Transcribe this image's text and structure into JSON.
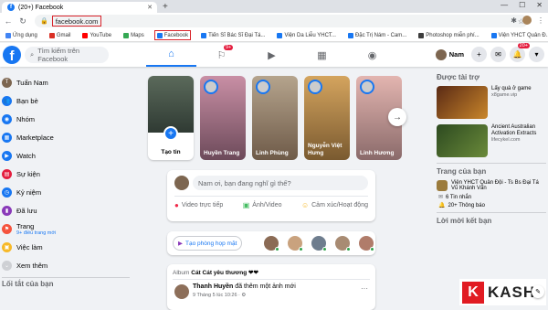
{
  "browser": {
    "tab_title": "(20+) Facebook",
    "url": "facebook.com",
    "bookmarks": [
      {
        "label": "Ứng dụng",
        "color": "#4285f4"
      },
      {
        "label": "Gmail",
        "color": "#d93025"
      },
      {
        "label": "YouTube",
        "color": "#ff0000"
      },
      {
        "label": "Maps",
        "color": "#34a853"
      },
      {
        "label": "Facebook",
        "color": "#1877f2"
      },
      {
        "label": "Tiến Sĩ Bác Sĩ Đại Tá...",
        "color": "#1877f2"
      },
      {
        "label": "Viện Da Liễu YHCT...",
        "color": "#1877f2"
      },
      {
        "label": "Đặc Trị Nám - Cam...",
        "color": "#1877f2"
      },
      {
        "label": "Photoshop miễn phí...",
        "color": "#3c3c3c"
      },
      {
        "label": "Viện YHCT Quân Đ...",
        "color": "#1877f2"
      }
    ]
  },
  "fb": {
    "search_placeholder": "Tìm kiếm trên Facebook",
    "nav_badge": "9+",
    "profile_name": "Nam",
    "notif_badge": "20+"
  },
  "leftnav": {
    "items": [
      {
        "label": "Tuấn Nam",
        "color": "#7d6650",
        "icon": "T"
      },
      {
        "label": "Bạn bè",
        "color": "#1877f2",
        "icon": "👥"
      },
      {
        "label": "Nhóm",
        "color": "#1877f2",
        "icon": "◉"
      },
      {
        "label": "Marketplace",
        "color": "#1877f2",
        "icon": "▦"
      },
      {
        "label": "Watch",
        "color": "#1877f2",
        "icon": "▶"
      },
      {
        "label": "Sự kiện",
        "color": "#e41e3f",
        "icon": "▤"
      },
      {
        "label": "Kỷ niệm",
        "color": "#1877f2",
        "icon": "◷"
      },
      {
        "label": "Đã lưu",
        "color": "#8a3ab9",
        "icon": "▮"
      },
      {
        "label": "Trang",
        "sub": "9+ điều trang mới",
        "color": "#f5533d",
        "icon": "⚑"
      },
      {
        "label": "Việc làm",
        "color": "#f7b928",
        "icon": "▣"
      },
      {
        "label": "Xem thêm",
        "color": "#ced0d4",
        "icon": "⌄"
      }
    ],
    "shortcuts_title": "Lối tắt của bạn"
  },
  "stories": {
    "create_label": "Tạo tin",
    "items": [
      {
        "name": "Huyền Trang",
        "bg": "linear-gradient(180deg,#c98fa5,#6d4a5a)"
      },
      {
        "name": "Linh Phùng",
        "bg": "linear-gradient(180deg,#b5a48d,#6e5a48)"
      },
      {
        "name": "Nguyễn Việt Hưng",
        "bg": "linear-gradient(180deg,#d4a45e,#7a5a30)"
      },
      {
        "name": "Linh Hương",
        "bg": "linear-gradient(180deg,#e3b5b0,#8a6a6a)"
      }
    ]
  },
  "composer": {
    "placeholder": "Nam ơi, bạn đang nghĩ gì thế?",
    "actions": [
      {
        "label": "Video trực tiếp",
        "icon": "●",
        "color": "#f02849"
      },
      {
        "label": "Ảnh/Video",
        "icon": "▣",
        "color": "#45bd62"
      },
      {
        "label": "Cảm xúc/Hoạt động",
        "icon": "☺",
        "color": "#f7b928"
      }
    ]
  },
  "rooms": {
    "button_label": "Tạo phòng họp mặt",
    "avatars": [
      "#8b6b55",
      "#c9a27e",
      "#6e7d8e",
      "#a88b73",
      "#b07c6a"
    ]
  },
  "post": {
    "album_prefix": "Album",
    "album_title": "Cát Cát yêu thương ❤❤",
    "author": "Thanh Huyền",
    "action": "đã thêm một ảnh mới",
    "meta": "9 Tháng 5 lúc 10:26 · ⚙"
  },
  "right": {
    "sponsored_title": "Được tài trợ",
    "ads": [
      {
        "text": "Lấy quà ở game",
        "domain": "x8game.vip",
        "bg": "linear-gradient(135deg,#5a2a15,#c9862a)"
      },
      {
        "text": "Ancient Australian Activation Extracts",
        "domain": "lifecykel.com",
        "bg": "linear-gradient(135deg,#2d4a20,#6a8a3a)"
      }
    ],
    "pages_title": "Trang của bạn",
    "page_name": "Viện YHCT Quân Đội - Ts Bs Đại Tá Vũ Khánh Vân",
    "page_stats": [
      {
        "icon": "✉",
        "text": "6 Tin nhắn"
      },
      {
        "icon": "🔔",
        "text": "20+ Thông báo"
      }
    ],
    "invite_title": "Lời mời kết bạn"
  },
  "watermark": {
    "letter": "K",
    "text": "KASHI"
  }
}
